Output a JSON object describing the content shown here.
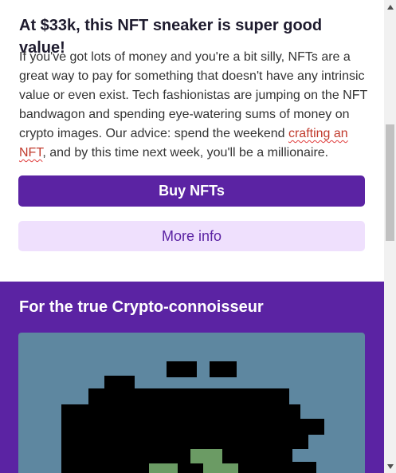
{
  "card1": {
    "title": "At $33k, this NFT sneaker is super good value!",
    "body_before": "If you've got lots of money and you're a bit silly, NFTs are a great way to pay for something that doesn't have any intrinsic value or even exist. Tech fashionistas are jumping on the NFT bandwagon and spending eye-watering sums of money on crypto images. Our advice: spend the weekend ",
    "link_text": "crafting an NFT",
    "body_after": ", and by this time next week, you'll be a millionaire.",
    "primary_button": "Buy NFTs",
    "secondary_button": "More info"
  },
  "card2": {
    "title": "For the true Crypto-connoisseur"
  },
  "colors": {
    "accent": "#5b23a3",
    "accent_light": "#efe0fd",
    "image_background": "#5e87a0",
    "pixel_black": "#000000",
    "pixel_green": "#6b9b64"
  },
  "icons": {
    "scroll_up": "triangle-up-icon",
    "scroll_down": "triangle-down-icon"
  }
}
